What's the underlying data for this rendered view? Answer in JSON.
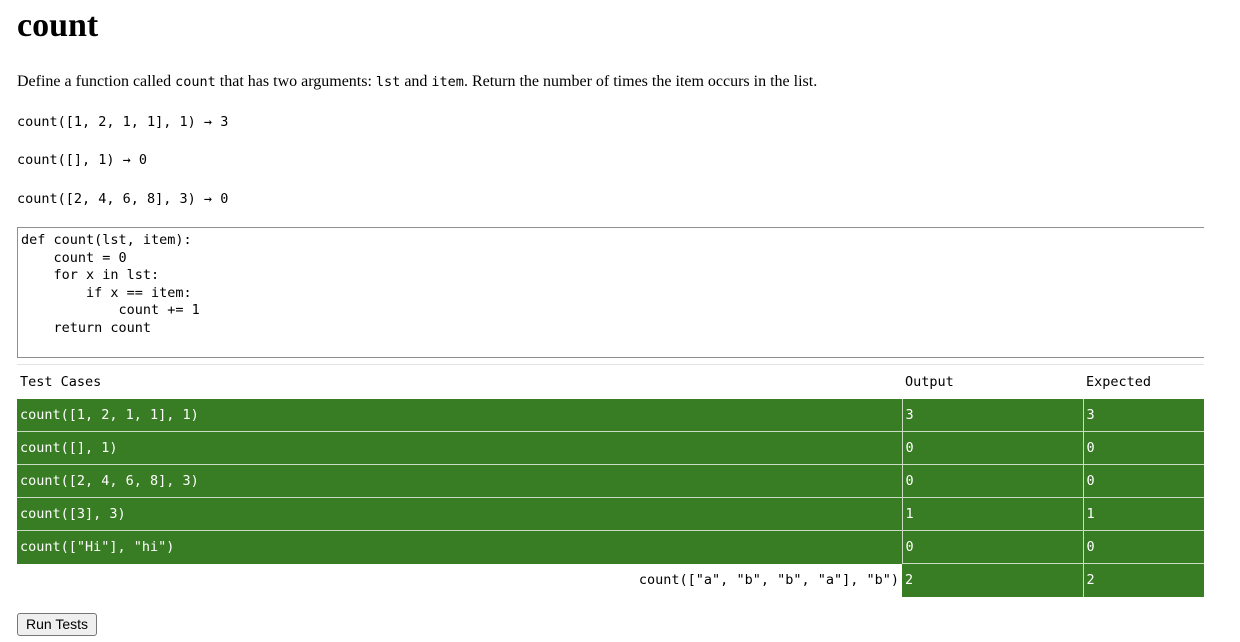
{
  "title": "count",
  "description": {
    "part1": "Define a function called ",
    "code1": "count",
    "part2": " that has two arguments: ",
    "code2": "lst",
    "part3": " and ",
    "code3": "item",
    "part4": ". Return the number of times the item occurs in the list."
  },
  "examples": [
    "count([1, 2, 1, 1], 1) → 3",
    "count([], 1) → 0",
    "count([2, 4, 6, 8], 3) → 0"
  ],
  "editor": {
    "code": "def count(lst, item):\n    count = 0\n    for x in lst:\n        if x == item:\n            count += 1\n    return count"
  },
  "table": {
    "headers": [
      "Test Cases",
      "Output",
      "Expected"
    ],
    "rows": [
      {
        "case": "count([1, 2, 1, 1], 1)",
        "output": "3",
        "expected": "3"
      },
      {
        "case": "count([], 1)",
        "output": "0",
        "expected": "0"
      },
      {
        "case": "count([2, 4, 6, 8], 3)",
        "output": "0",
        "expected": "0"
      },
      {
        "case": "count([3], 3)",
        "output": "1",
        "expected": "1"
      },
      {
        "case": "count([\"Hi\"], \"hi\")",
        "output": "0",
        "expected": "0"
      },
      {
        "case": "count([\"a\", \"b\", \"b\", \"a\"], \"b\")",
        "output": "2",
        "expected": "2"
      }
    ]
  },
  "run_button_label": "Run Tests",
  "colors": {
    "pass": "#387d23"
  }
}
